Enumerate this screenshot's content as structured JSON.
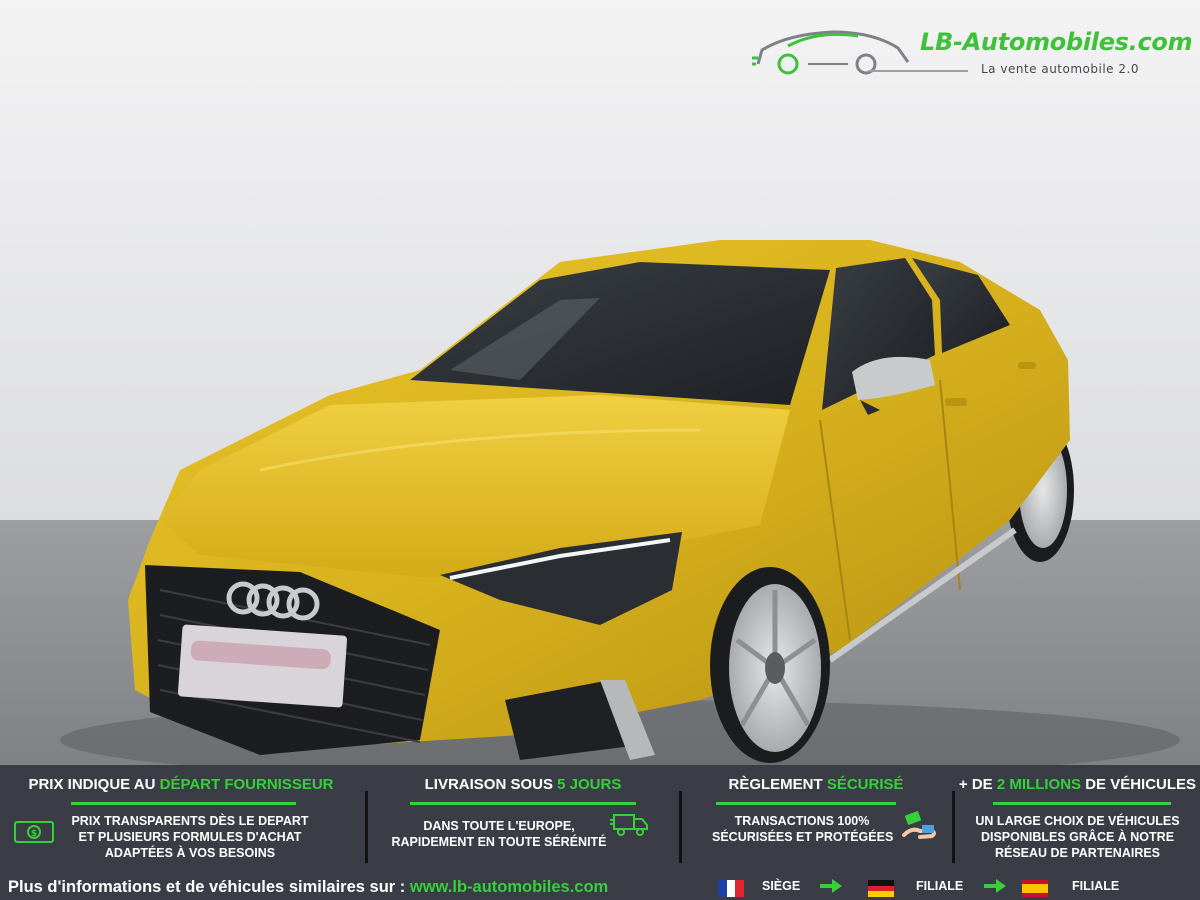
{
  "logo": {
    "title": "LB-Automobiles.com",
    "tagline": "La vente automobile 2.0",
    "icon": "car-logo-icon"
  },
  "photo": {
    "subject": "car-photo",
    "body_color": "#d8b21d"
  },
  "features": [
    {
      "title_pre": "PRIX INDIQUE AU ",
      "title_hl": "DÉPART FOURNISSEUR",
      "title_post": "",
      "lines": [
        "PRIX TRANSPARENTS DÈS LE DEPART",
        "ET PLUSIEURS FORMULES D'ACHAT",
        "ADAPTÉES À VOS BESOINS"
      ],
      "icon": "money-icon"
    },
    {
      "title_pre": "LIVRAISON SOUS ",
      "title_hl": "5 JOURS",
      "title_post": "",
      "lines": [
        "DANS TOUTE L'EUROPE,",
        "RAPIDEMENT EN TOUTE SÉRÉNITÉ"
      ],
      "icon": "delivery-truck-icon"
    },
    {
      "title_pre": "RÈGLEMENT ",
      "title_hl": "SÉCURISÉ",
      "title_post": "",
      "lines": [
        "TRANSACTIONS 100%",
        "SÉCURISÉES ET PROTÉGÉES"
      ],
      "icon": "payment-hand-icon"
    },
    {
      "title_pre": "+ DE ",
      "title_hl": "2 MILLIONS",
      "title_post": " DE VÉHICULES",
      "lines": [
        "UN LARGE CHOIX DE VÉHICULES",
        "DISPONIBLES GRÂCE À NOTRE",
        "RÉSEAU DE PARTENAIRES"
      ],
      "icon": ""
    }
  ],
  "footer": {
    "info_text": "Plus d'informations et de véhicules similaires sur : ",
    "url": "www.lb-automobiles.com",
    "locations": [
      {
        "flag": "france-flag-icon",
        "label": "SIÈGE"
      },
      {
        "flag": "germany-flag-icon",
        "label": "FILIALE"
      },
      {
        "flag": "spain-flag-icon",
        "label": "FILIALE"
      }
    ]
  },
  "colors": {
    "accent_green": "#35d03a",
    "band_background": "#3a3d45",
    "car_yellow": "#d8b21d"
  }
}
